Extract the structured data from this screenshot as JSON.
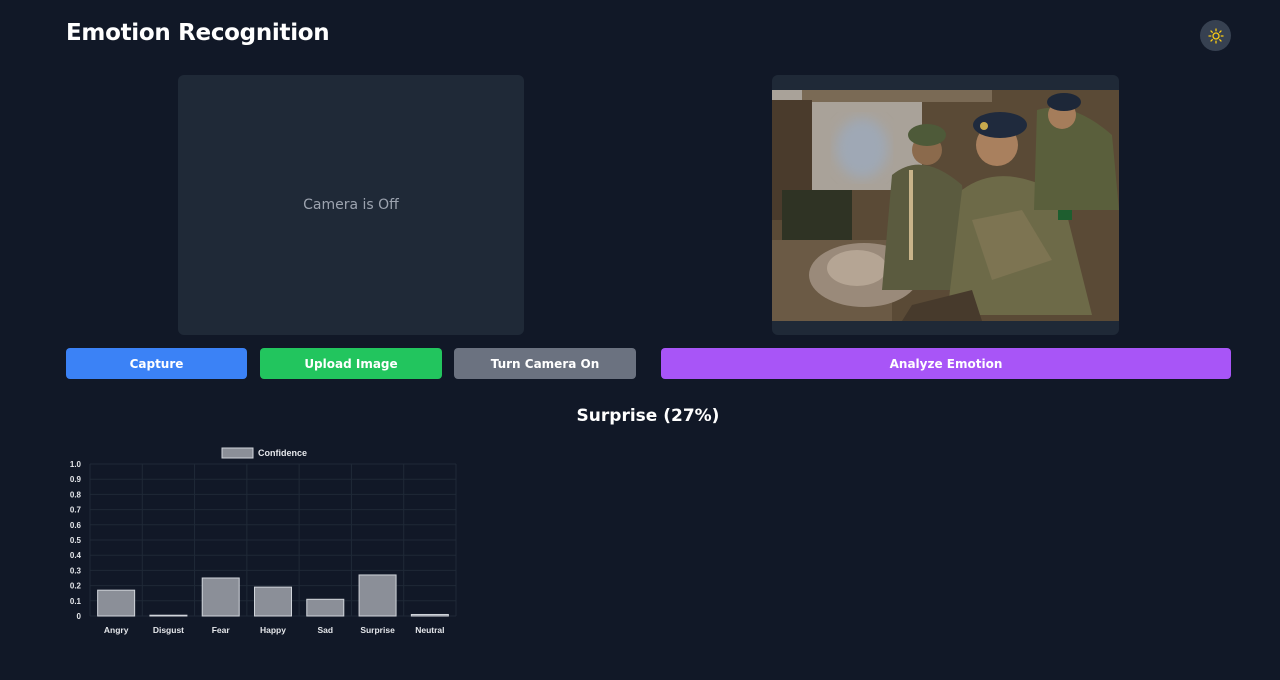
{
  "app": {
    "title": "Emotion Recognition"
  },
  "theme_toggle": {
    "icon": "sun-icon",
    "color": "#facc15"
  },
  "camera": {
    "status": "Camera is Off"
  },
  "preview": {
    "alt": "Uploaded photo of soldiers in camouflage uniforms"
  },
  "buttons": {
    "capture": "Capture",
    "upload": "Upload Image",
    "camera_toggle": "Turn Camera On",
    "analyze": "Analyze Emotion"
  },
  "colors": {
    "background": "#111827",
    "panel": "#1f2937",
    "capture": "#3b82f6",
    "upload": "#22c55e",
    "camera_toggle": "#6b7280",
    "analyze": "#a855f7",
    "bar_fill": "#8b8f98",
    "bar_border": "#d1d5db"
  },
  "result": {
    "label": "Surprise (27%)"
  },
  "chart_data": {
    "type": "bar",
    "categories": [
      "Angry",
      "Disgust",
      "Fear",
      "Happy",
      "Sad",
      "Surprise",
      "Neutral"
    ],
    "series": [
      {
        "name": "Confidence",
        "values": [
          0.17,
          0.0,
          0.25,
          0.19,
          0.11,
          0.27,
          0.01
        ]
      }
    ],
    "yticks": [
      "0",
      "0.1",
      "0.2",
      "0.3",
      "0.4",
      "0.5",
      "0.6",
      "0.7",
      "0.8",
      "0.9",
      "1.0"
    ],
    "ylim": [
      0,
      1
    ],
    "grid": true,
    "legend": "top-center"
  }
}
